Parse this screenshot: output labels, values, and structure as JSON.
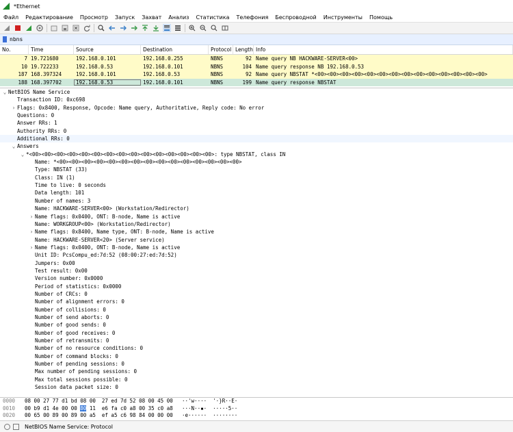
{
  "window": {
    "title": "*Ethernet"
  },
  "menu": [
    "Файл",
    "Редактирование",
    "Просмотр",
    "Запуск",
    "Захват",
    "Анализ",
    "Статистика",
    "Телефония",
    "Беспроводной",
    "Инструменты",
    "Помощь"
  ],
  "filter": {
    "value": "nbns"
  },
  "packet_list": {
    "columns": [
      "No.",
      "Time",
      "Source",
      "Destination",
      "Protocol",
      "Length",
      "Info"
    ],
    "rows": [
      {
        "no": "7",
        "time": "19.721680",
        "src": "192.168.0.101",
        "dst": "192.168.0.255",
        "proto": "NBNS",
        "len": "92",
        "info": "Name query NB HACKWARE-SERVER<00>"
      },
      {
        "no": "10",
        "time": "19.722233",
        "src": "192.168.0.53",
        "dst": "192.168.0.101",
        "proto": "NBNS",
        "len": "104",
        "info": "Name query response NB 192.168.0.53"
      },
      {
        "no": "187",
        "time": "168.397324",
        "src": "192.168.0.101",
        "dst": "192.168.0.53",
        "proto": "NBNS",
        "len": "92",
        "info": "Name query NBSTAT *<00><00><00><00><00><00><00><00><00><00><00><00><00><00>"
      },
      {
        "no": "188",
        "time": "168.397702",
        "src": "192.168.0.53",
        "dst": "192.168.0.101",
        "proto": "NBNS",
        "len": "199",
        "info": "Name query response NBSTAT"
      }
    ]
  },
  "details": [
    {
      "caret": "v",
      "indent": 0,
      "text": "NetBIOS Name Service"
    },
    {
      "caret": "",
      "indent": 1,
      "text": "Transaction ID: 0xc698"
    },
    {
      "caret": ">",
      "indent": 1,
      "text": "Flags: 0x8400, Response, Opcode: Name query, Authoritative, Reply code: No error"
    },
    {
      "caret": "",
      "indent": 1,
      "text": "Questions: 0"
    },
    {
      "caret": "",
      "indent": 1,
      "text": "Answer RRs: 1"
    },
    {
      "caret": "",
      "indent": 1,
      "text": "Authority RRs: 0"
    },
    {
      "caret": "",
      "indent": 1,
      "text": "Additional RRs: 0",
      "hl": true
    },
    {
      "caret": "v",
      "indent": 1,
      "text": "Answers"
    },
    {
      "caret": "v",
      "indent": 2,
      "text": "*<00><00><00><00><00><00><00><00><00><00><00><00><00><00><00>: type NBSTAT, class IN"
    },
    {
      "caret": "",
      "indent": 3,
      "text": "Name: *<00><00><00><00><00><00><00><00><00><00><00><00><00><00><00>"
    },
    {
      "caret": "",
      "indent": 3,
      "text": "Type: NBSTAT (33)"
    },
    {
      "caret": "",
      "indent": 3,
      "text": "Class: IN (1)"
    },
    {
      "caret": "",
      "indent": 3,
      "text": "Time to live: 0 seconds"
    },
    {
      "caret": "",
      "indent": 3,
      "text": "Data length: 101"
    },
    {
      "caret": "",
      "indent": 3,
      "text": "Number of names: 3"
    },
    {
      "caret": "",
      "indent": 3,
      "text": "Name: HACKWARE-SERVER<00> (Workstation/Redirector)"
    },
    {
      "caret": ">",
      "indent": 3,
      "text": "Name flags: 0x0400, ONT: B-node, Name is active"
    },
    {
      "caret": "",
      "indent": 3,
      "text": "Name: WORKGROUP<00> (Workstation/Redirector)"
    },
    {
      "caret": ">",
      "indent": 3,
      "text": "Name flags: 0x8400, Name type, ONT: B-node, Name is active"
    },
    {
      "caret": "",
      "indent": 3,
      "text": "Name: HACKWARE-SERVER<20> (Server service)"
    },
    {
      "caret": ">",
      "indent": 3,
      "text": "Name flags: 0x0400, ONT: B-node, Name is active"
    },
    {
      "caret": "",
      "indent": 3,
      "text": "Unit ID: PcsCompu_ed:7d:52 (08:00:27:ed:7d:52)"
    },
    {
      "caret": "",
      "indent": 3,
      "text": "Jumpers: 0x00"
    },
    {
      "caret": "",
      "indent": 3,
      "text": "Test result: 0x00"
    },
    {
      "caret": "",
      "indent": 3,
      "text": "Version number: 0x0000"
    },
    {
      "caret": "",
      "indent": 3,
      "text": "Period of statistics: 0x0000"
    },
    {
      "caret": "",
      "indent": 3,
      "text": "Number of CRCs: 0"
    },
    {
      "caret": "",
      "indent": 3,
      "text": "Number of alignment errors: 0"
    },
    {
      "caret": "",
      "indent": 3,
      "text": "Number of collisions: 0"
    },
    {
      "caret": "",
      "indent": 3,
      "text": "Number of send aborts: 0"
    },
    {
      "caret": "",
      "indent": 3,
      "text": "Number of good sends: 0"
    },
    {
      "caret": "",
      "indent": 3,
      "text": "Number of good receives: 0"
    },
    {
      "caret": "",
      "indent": 3,
      "text": "Number of retransmits: 0"
    },
    {
      "caret": "",
      "indent": 3,
      "text": "Number of no resource conditions: 0"
    },
    {
      "caret": "",
      "indent": 3,
      "text": "Number of command blocks: 0"
    },
    {
      "caret": "",
      "indent": 3,
      "text": "Number of pending sessions: 0"
    },
    {
      "caret": "",
      "indent": 3,
      "text": "Max number of pending sessions: 0"
    },
    {
      "caret": "",
      "indent": 3,
      "text": "Max total sessions possible: 0"
    },
    {
      "caret": "",
      "indent": 3,
      "text": "Session data packet size: 0"
    }
  ],
  "hex": [
    {
      "offset": "0000",
      "before": "08 00 27 77 d1 bd 08 00  27 ed 7d 52 08 00 45 00",
      "selected": "",
      "after": "",
      "ascii": "··'w····  '·}R··E·"
    },
    {
      "offset": "0010",
      "before": "00 b9 d1 4e 00 00 ",
      "selected": "80",
      "after": " 11  e6 fa c0 a8 00 35 c0 a8",
      "ascii": "···N··▪·  ·····5··"
    },
    {
      "offset": "0020",
      "before": "00 65 00 89 00 89 00 a5  ef a5 c6 98 84 00 00 00",
      "selected": "",
      "after": "",
      "ascii": "·e······  ········"
    }
  ],
  "status": {
    "text": "NetBIOS Name Service: Protocol"
  }
}
